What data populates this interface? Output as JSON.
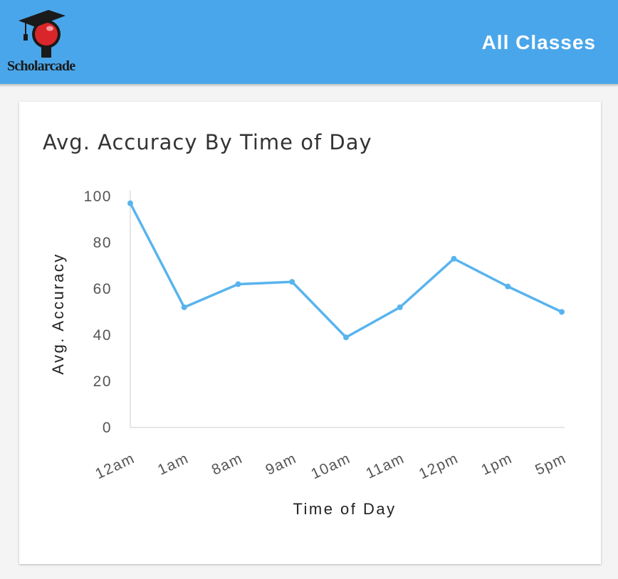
{
  "header": {
    "logo_text": "Scholarcade",
    "title": "All Classes"
  },
  "colors": {
    "header_bg": "#4aa6ea",
    "line": "#58b4ee",
    "logo_ball": "#d9262a"
  },
  "chart_data": {
    "type": "line",
    "title": "Avg. Accuracy By Time of Day",
    "xlabel": "Time of Day",
    "ylabel": "Avg. Accuracy",
    "categories": [
      "12am",
      "1am",
      "8am",
      "9am",
      "10am",
      "11am",
      "12pm",
      "1pm",
      "5pm"
    ],
    "values": [
      97,
      52,
      62,
      63,
      39,
      52,
      73,
      61,
      50
    ],
    "ylim": [
      0,
      100
    ],
    "yticks": [
      0,
      20,
      40,
      60,
      80,
      100
    ],
    "grid": false,
    "legend": "none"
  }
}
